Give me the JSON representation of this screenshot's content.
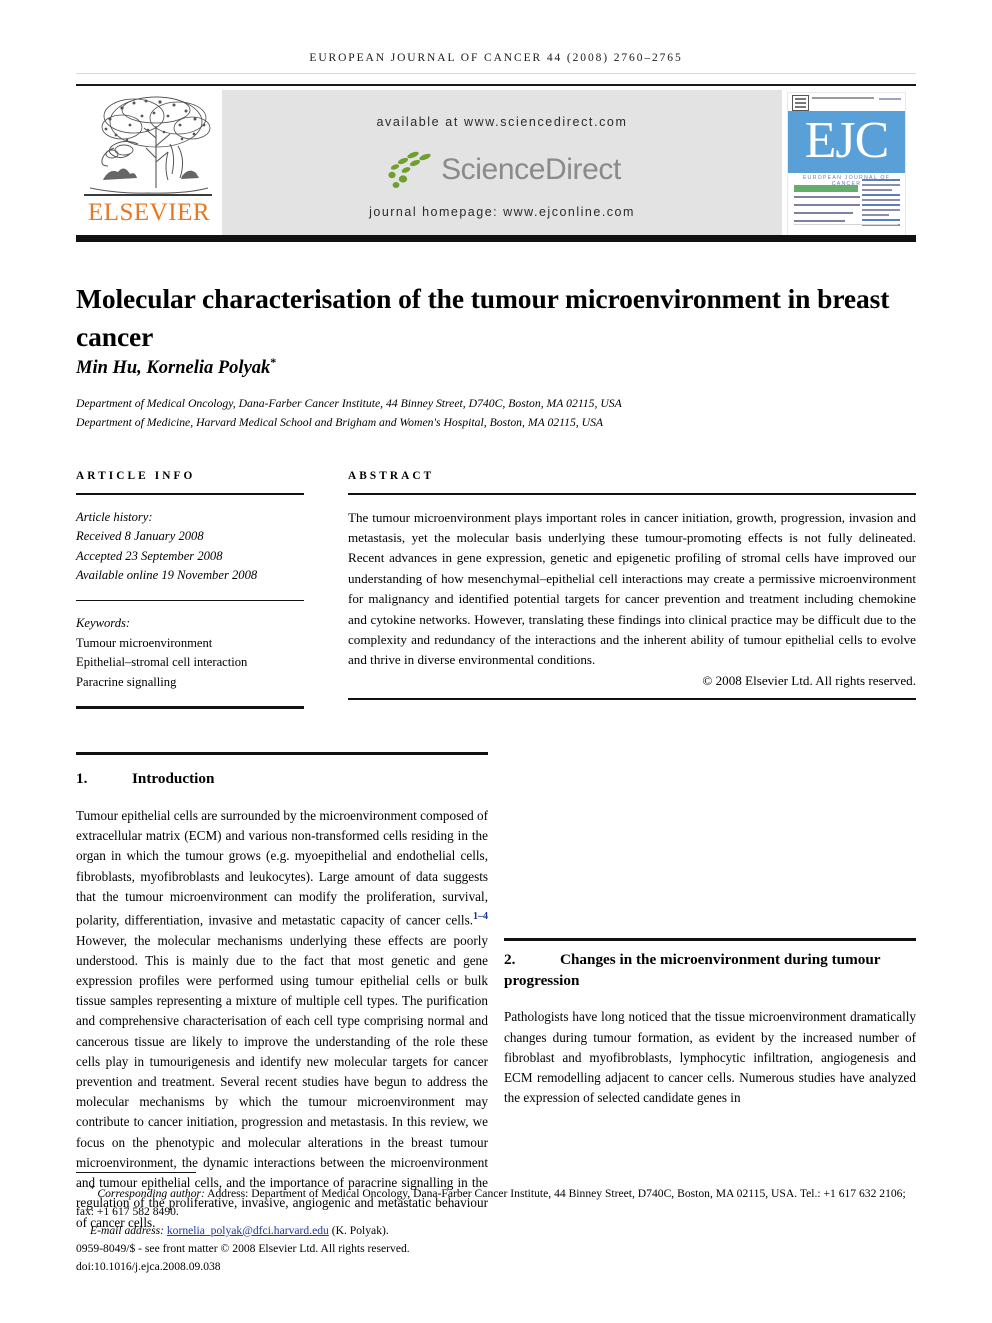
{
  "running_head": "EUROPEAN JOURNAL OF CANCER 44 (2008) 2760–2765",
  "masthead": {
    "publisher_wordmark": "ELSEVIER",
    "available_at": "available at www.sciencedirect.com",
    "sciencedirect_wordmark": "ScienceDirect",
    "journal_homepage": "journal homepage: www.ejconline.com",
    "cover": {
      "acronym": "EJC",
      "journal_line": "EUROPEAN JOURNAL OF CANCER"
    },
    "colors": {
      "elsevier_orange": "#e87722",
      "sciencedirect_green": "#6f9f2f",
      "sciencedirect_grey": "#8a8a8a",
      "cover_blue": "#59a0d8",
      "banner_grey": "#e3e3e3"
    }
  },
  "article": {
    "title": "Molecular characterisation of the tumour microenvironment in breast cancer",
    "authors": "Min Hu, Kornelia Polyak",
    "author_marker": "*",
    "affiliations": [
      "Department of Medical Oncology, Dana-Farber Cancer Institute, 44 Binney Street, D740C, Boston, MA 02115, USA",
      "Department of Medicine, Harvard Medical School and Brigham and Women's Hospital, Boston, MA 02115, USA"
    ]
  },
  "article_info": {
    "heading": "ARTICLE INFO",
    "history_label": "Article history:",
    "history": [
      "Received 8 January 2008",
      "Accepted 23 September 2008",
      "Available online 19 November 2008"
    ],
    "keywords_label": "Keywords:",
    "keywords": [
      "Tumour microenvironment",
      "Epithelial–stromal cell interaction",
      "Paracrine signalling"
    ]
  },
  "abstract": {
    "heading": "ABSTRACT",
    "text": "The tumour microenvironment plays important roles in cancer initiation, growth, progression, invasion and metastasis, yet the molecular basis underlying these tumour-promoting effects is not fully delineated. Recent advances in gene expression, genetic and epigenetic profiling of stromal cells have improved our understanding of how mesenchymal–epithelial cell interactions may create a permissive microenvironment for malignancy and identified potential targets for cancer prevention and treatment including chemokine and cytokine networks. However, translating these findings into clinical practice may be difficult due to the complexity and redundancy of the interactions and the inherent ability of tumour epithelial cells to evolve and thrive in diverse environmental conditions.",
    "copyright": "© 2008 Elsevier Ltd. All rights reserved."
  },
  "body": {
    "section1": {
      "number": "1.",
      "title": "Introduction",
      "para_a": "Tumour epithelial cells are surrounded by the microenvironment composed of extracellular matrix (ECM) and various non-transformed cells residing in the organ in which the tumour grows (e.g. myoepithelial and endothelial cells, fibroblasts, myofibroblasts and leukocytes). Large amount of data suggests that the tumour microenvironment can modify the proliferation, survival, polarity, differentiation, invasive and metastatic capacity of cancer cells.",
      "ref_marker": "1–4",
      "para_b": "However, the molecular mechanisms underlying these effects are poorly understood. This is mainly due to the fact that most genetic and gene expression profiles were performed using tumour epithelial cells or bulk tissue samples representing a mixture of multiple cell types. The purification and comprehensive characterisation of each cell type comprising normal and cancerous tissue are likely to improve the understanding of the role these cells play in tumourigenesis and identify new molecular targets for cancer prevention and treatment. Several recent studies have begun to address the molecular mechanisms by which the tumour microenvironment may contribute to cancer initiation, progression and metastasis. In this review, we focus on the phenotypic and molecular alterations in the breast tumour microenvironment, the dynamic interactions between the microenvironment and tumour epithelial cells, and the importance of paracrine signalling in the regulation of the proliferative, invasive, angiogenic and metastatic behaviour of cancer cells."
    },
    "section2": {
      "number": "2.",
      "title": "Changes in the microenvironment during tumour progression",
      "para": "Pathologists have long noticed that the tissue microenvironment dramatically changes during tumour formation, as evident by the increased number of fibroblast and myofibroblasts, lymphocytic infiltration, angiogenesis and ECM remodelling adjacent to cancer cells. Numerous studies have analyzed the expression of selected candidate genes in"
    }
  },
  "footnote": {
    "star": "*",
    "corresponding_label": "Corresponding author:",
    "corresponding_text": " Address: Department of Medical Oncology, Dana-Farber Cancer Institute, 44 Binney Street, D740C, Boston, MA 02115, USA. Tel.: +1 617 632 2106; fax: +1 617 582 8490.",
    "email_label": "E-mail address:",
    "email": "kornelia_polyak@dfci.harvard.edu",
    "email_suffix": "(K. Polyak).",
    "front_matter": "0959-8049/$ - see front matter © 2008 Elsevier Ltd. All rights reserved.",
    "doi": "doi:10.1016/j.ejca.2008.09.038"
  }
}
